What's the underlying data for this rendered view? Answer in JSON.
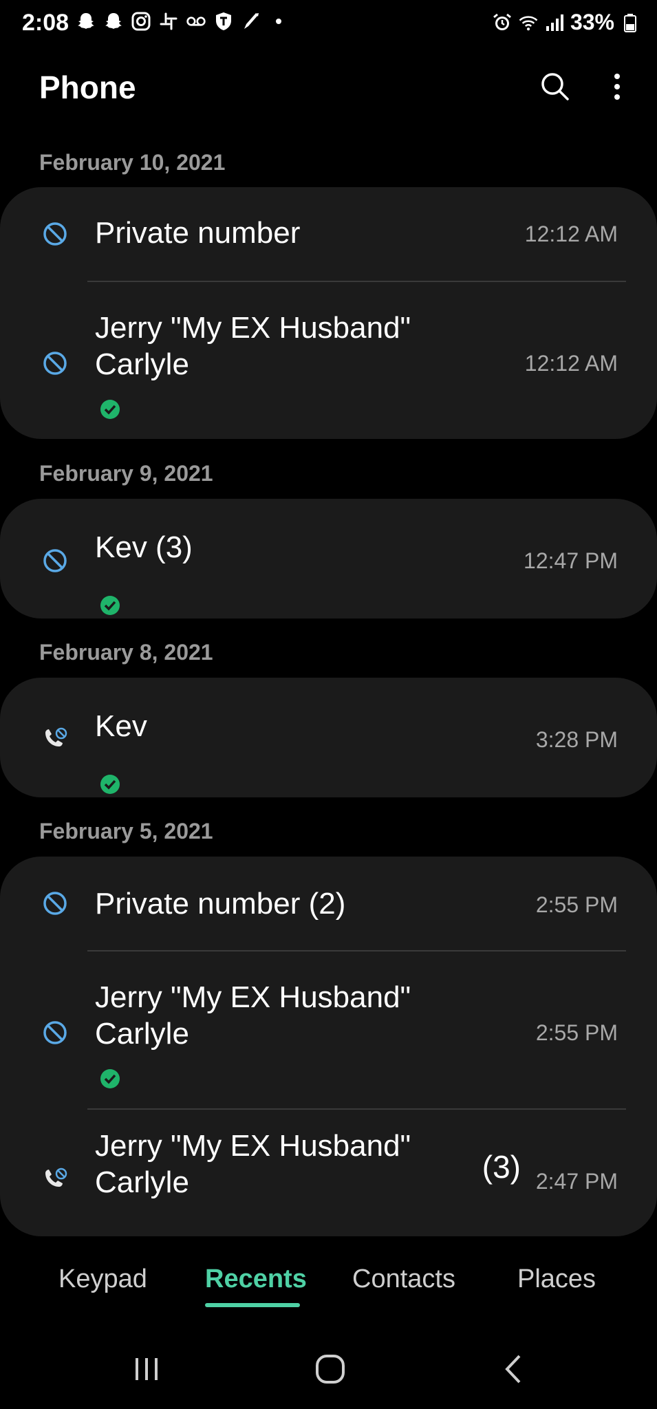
{
  "status_bar": {
    "time": "2:08",
    "battery": "33%",
    "left_icons": [
      "snapchat-icon",
      "snapchat-icon",
      "instagram-icon",
      "slack-icon",
      "voicemail-icon",
      "tmobile-icon",
      "app-icon",
      "dot-icon"
    ],
    "right_icons": [
      "alarm-icon",
      "wifi-icon",
      "signal-icon",
      "battery-icon"
    ]
  },
  "header": {
    "title": "Phone",
    "search_icon": "search-icon",
    "more_icon": "more-vert-icon"
  },
  "sections": [
    {
      "date": "February 10, 2021",
      "calls": [
        {
          "name": "Private number",
          "time": "12:12 AM",
          "icon": "blocked-icon",
          "verified": false
        },
        {
          "name": "Jerry \"My EX Husband\" Carlyle",
          "time": "12:12 AM",
          "icon": "blocked-icon",
          "verified": true
        }
      ]
    },
    {
      "date": "February 9, 2021",
      "calls": [
        {
          "name": "Kev (3)",
          "time": "12:47 PM",
          "icon": "blocked-icon",
          "verified": true
        }
      ]
    },
    {
      "date": "February 8, 2021",
      "calls": [
        {
          "name": "Kev",
          "time": "3:28 PM",
          "icon": "rejected-call-icon",
          "verified": true
        }
      ]
    },
    {
      "date": "February 5, 2021",
      "calls": [
        {
          "name": "Private number (2)",
          "time": "2:55 PM",
          "icon": "blocked-icon",
          "verified": false
        },
        {
          "name": "Jerry \"My EX Husband\" Carlyle",
          "time": "2:55 PM",
          "icon": "blocked-icon",
          "verified": true
        },
        {
          "name": "Jerry \"My EX Husband\" Carlyle",
          "count": "(3)",
          "time": "2:47 PM",
          "icon": "rejected-call-icon",
          "verified": false
        }
      ]
    }
  ],
  "tabs": [
    {
      "label": "Keypad",
      "active": false
    },
    {
      "label": "Recents",
      "active": true
    },
    {
      "label": "Contacts",
      "active": false
    },
    {
      "label": "Places",
      "active": false
    }
  ],
  "colors": {
    "accent": "#4fd1a5",
    "blocked_icon": "#5aa9e6",
    "verified": "#1fb46a",
    "card_bg": "#1b1b1b"
  }
}
